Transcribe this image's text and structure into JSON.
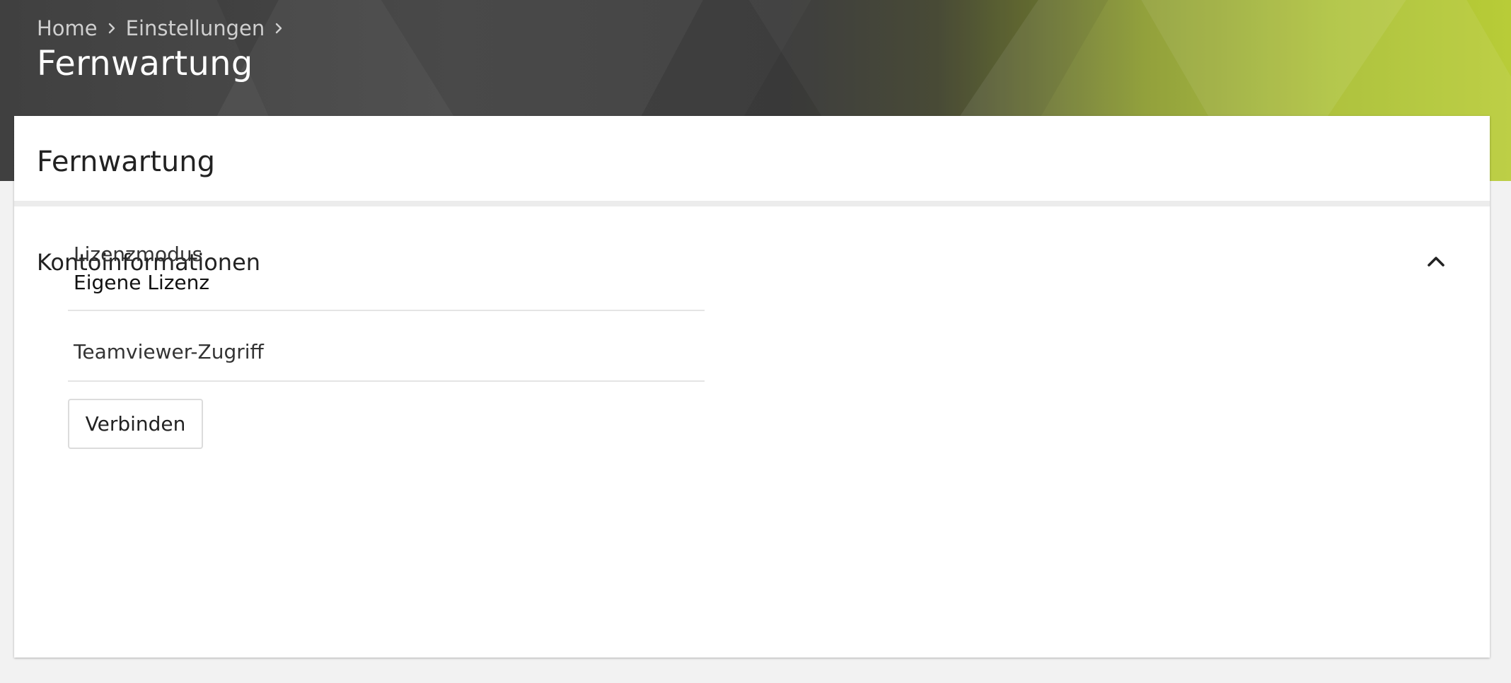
{
  "breadcrumb": {
    "items": [
      {
        "label": "Home"
      },
      {
        "label": "Einstellungen"
      }
    ]
  },
  "page": {
    "title": "Fernwartung"
  },
  "card": {
    "title": "Fernwartung",
    "section": {
      "title": "Kontoinformationen",
      "collapse_icon": "chevron-up-icon",
      "fields": [
        {
          "label": "Lizenzmodus",
          "value": "Eigene Lizenz"
        },
        {
          "label": "Teamviewer-Zugriff",
          "value": ""
        }
      ],
      "connect_button": "Verbinden"
    }
  },
  "colors": {
    "hero_dark": "#3a3a3a",
    "hero_accent": "#b8cc38",
    "page_background": "#f2f2f2"
  }
}
